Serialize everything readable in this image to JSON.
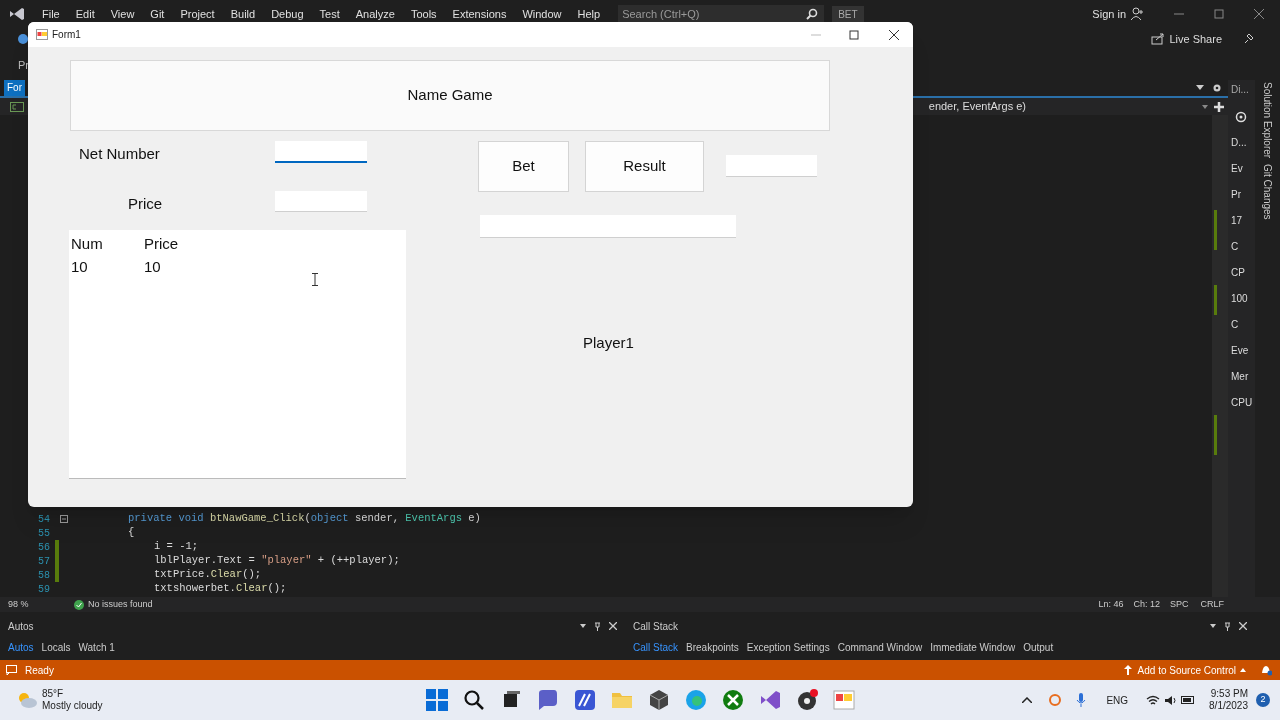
{
  "menu_bar": {
    "items": [
      "File",
      "Edit",
      "View",
      "Git",
      "Project",
      "Build",
      "Debug",
      "Test",
      "Analyze",
      "Tools",
      "Extensions",
      "Window",
      "Help"
    ],
    "search_placeholder": "Search (Ctrl+Q)",
    "solution": "BET",
    "sign_in": "Sign in"
  },
  "toolbar": {
    "fragment": "Pr",
    "live_share": "Live Share"
  },
  "document_tab": {
    "label": "For",
    "selected": true
  },
  "navigation": {
    "member": "ender, EventArgs e)"
  },
  "editor": {
    "lines": [
      {
        "number": "54",
        "kind": "outer",
        "foldable": true,
        "changed": false,
        "tokens": [
          {
            "kind": "keyword",
            "text": "private "
          },
          {
            "kind": "keyword",
            "text": "void "
          },
          {
            "kind": "method",
            "text": "btNawGame_Click"
          },
          {
            "kind": "plain",
            "text": "("
          },
          {
            "kind": "keyword",
            "text": "object"
          },
          {
            "kind": "plain",
            "text": " sender, "
          },
          {
            "kind": "type",
            "text": "EventArgs"
          },
          {
            "kind": "plain",
            "text": " e)"
          }
        ]
      },
      {
        "number": "55",
        "kind": "outer",
        "foldable": false,
        "changed": false,
        "tokens": [
          {
            "kind": "plain",
            "text": "{"
          }
        ]
      },
      {
        "number": "56",
        "kind": "inner",
        "foldable": false,
        "changed": true,
        "tokens": [
          {
            "kind": "plain",
            "text": "i = -1;"
          }
        ]
      },
      {
        "number": "57",
        "kind": "inner",
        "foldable": false,
        "changed": true,
        "tokens": [
          {
            "kind": "plain",
            "text": "lblPlayer.Text = "
          },
          {
            "kind": "string",
            "text": "\"player\""
          },
          {
            "kind": "plain",
            "text": " + (++player);"
          }
        ]
      },
      {
        "number": "58",
        "kind": "inner",
        "foldable": false,
        "changed": true,
        "tokens": [
          {
            "kind": "plain",
            "text": "txtPrice."
          },
          {
            "kind": "method",
            "text": "Clear"
          },
          {
            "kind": "plain",
            "text": "();"
          }
        ]
      },
      {
        "number": "59",
        "kind": "inner",
        "foldable": false,
        "changed": false,
        "tokens": [
          {
            "kind": "plain",
            "text": "txtshowerbet."
          },
          {
            "kind": "method",
            "text": "Clear"
          },
          {
            "kind": "plain",
            "text": "();"
          }
        ]
      }
    ]
  },
  "diagnostics": {
    "title": "Di...",
    "items": [
      "D...",
      "Ev",
      "Pr",
      "17",
      "C",
      "CP",
      "100",
      "C",
      "Eve",
      "Mer",
      "CPU"
    ]
  },
  "side_tabs": [
    "Solution Explorer",
    "Git Changes"
  ],
  "status_line": {
    "zoom": "98 %",
    "issues": "No issues found",
    "line": "Ln: 46",
    "column": "Ch: 12",
    "spacing": "SPC",
    "line_ending": "CRLF"
  },
  "autos_panel": {
    "title": "Autos",
    "tabs": [
      {
        "label": "Autos",
        "selected": true
      },
      {
        "label": "Locals",
        "selected": false
      },
      {
        "label": "Watch 1",
        "selected": false
      }
    ]
  },
  "call_stack_panel": {
    "title": "Call Stack",
    "tabs": [
      {
        "label": "Call Stack",
        "selected": true
      },
      {
        "label": "Breakpoints",
        "selected": false
      },
      {
        "label": "Exception Settings",
        "selected": false
      },
      {
        "label": "Command Window",
        "selected": false
      },
      {
        "label": "Immediate Window",
        "selected": false
      },
      {
        "label": "Output",
        "selected": false
      }
    ]
  },
  "status_bar": {
    "text": "Ready",
    "source_control": "Add to Source Control"
  },
  "taskbar": {
    "temperature": "85°F",
    "weather": "Mostly cloudy",
    "language": "ENG",
    "time": "9:53 PM",
    "date": "8/1/2023",
    "notification_count": "2"
  },
  "form": {
    "title": "Form1",
    "heading": "Name Game",
    "net_number_label": "Net Number",
    "price_label": "Price",
    "fields": [
      {
        "focused": true
      },
      {
        "focused": false
      },
      {
        "focused": false
      },
      {
        "focused": false
      }
    ],
    "bet_button": "Bet",
    "result_button": "Result",
    "list": {
      "columns": [
        "Num",
        "Price"
      ],
      "rows": [
        [
          "10",
          "10"
        ]
      ]
    },
    "player_label": "Player1"
  }
}
